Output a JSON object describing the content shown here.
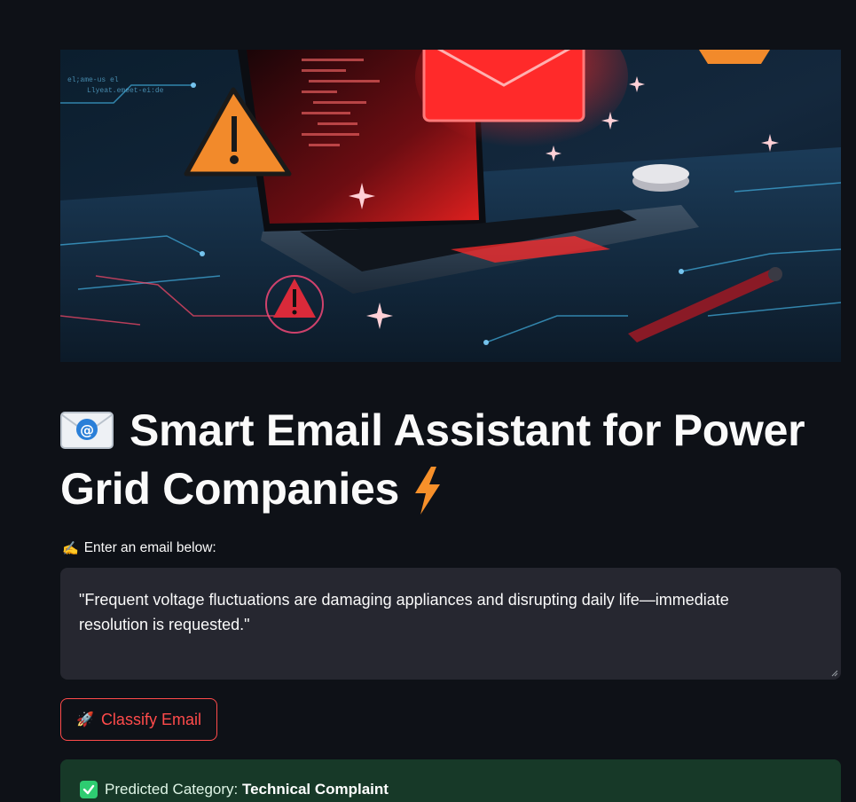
{
  "hero_image": {
    "description_icon": "laptop-email-warning-illustration"
  },
  "header": {
    "title_icon": "envelope-emoji-icon",
    "title": "Smart Email Assistant for Power Grid Companies",
    "title_trailing_icon": "lightning-emoji-icon"
  },
  "input": {
    "label_icon": "writing-hand-icon",
    "label": "Enter an email below:",
    "value": "\"Frequent voltage fluctuations are damaging appliances and disrupting daily life—immediate resolution is requested.\""
  },
  "actions": {
    "classify_icon": "rocket-icon",
    "classify_label": "Classify Email"
  },
  "result": {
    "icon": "check-mark-icon",
    "prefix": "Predicted Category: ",
    "category": "Technical Complaint"
  },
  "colors": {
    "background": "#0e1117",
    "input_bg": "#262730",
    "accent": "#ff4b4b",
    "success_bg": "#173928",
    "success_check": "#2ecc71"
  }
}
